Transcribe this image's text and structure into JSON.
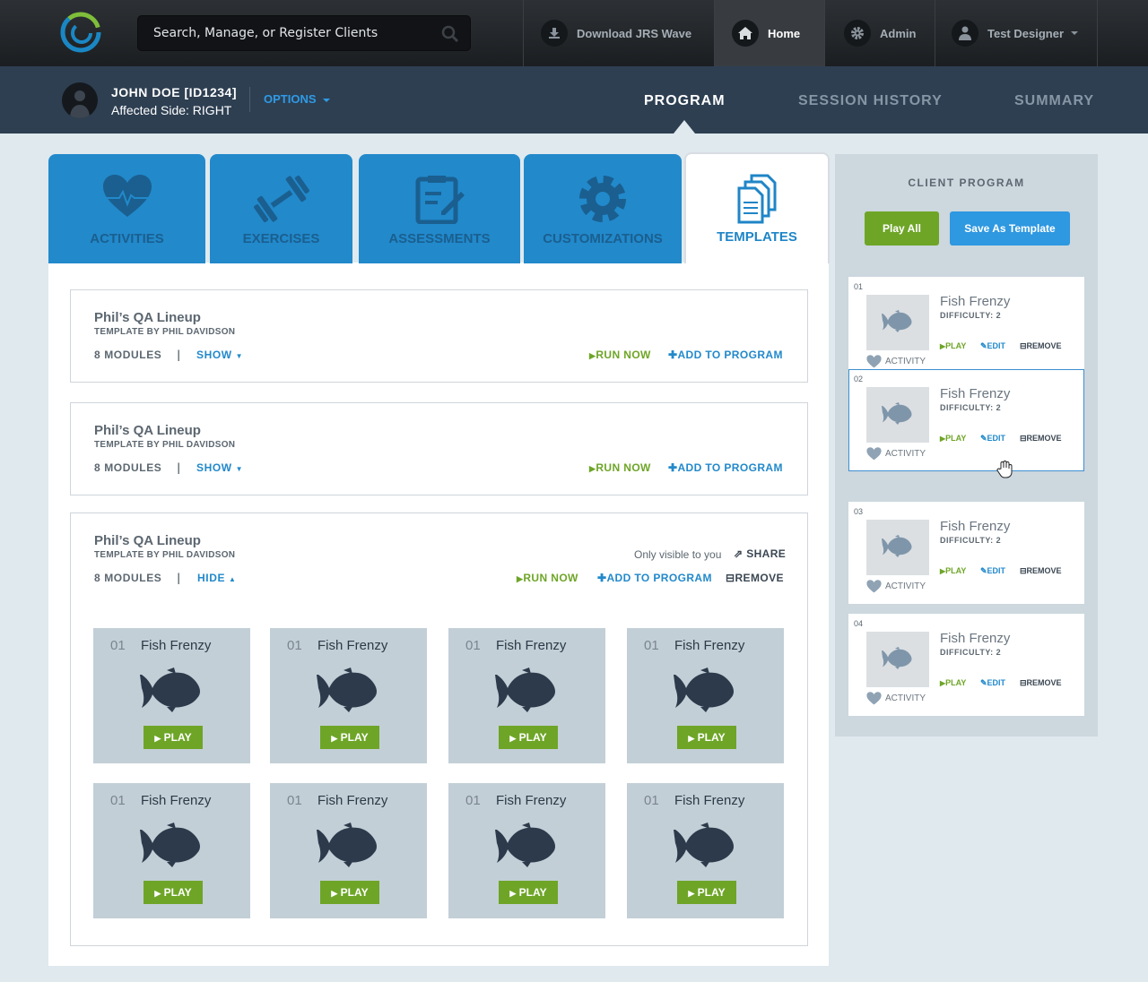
{
  "search": {
    "placeholder": "Search, Manage, or Register Clients"
  },
  "nav": {
    "download": "Download JRS Wave",
    "home": "Home",
    "admin": "Admin",
    "user": "Test Designer"
  },
  "client": {
    "name": "JOHN DOE [ID1234]",
    "side": "Affected Side: RIGHT",
    "options": "OPTIONS"
  },
  "client_tabs": {
    "program": "PROGRAM",
    "history": "SESSION HISTORY",
    "summary": "SUMMARY"
  },
  "category_tabs": {
    "activities": "ACTIVITIES",
    "exercises": "EXERCISES",
    "assessments": "ASSESSMENTS",
    "customizations": "CUSTOMIZATIONS",
    "templates": "TEMPLATES"
  },
  "templates": [
    {
      "title": "Phil’s QA Lineup",
      "by": "TEMPLATE BY PHIL DAVIDSON",
      "modules": "8 MODULES",
      "toggle": "SHOW",
      "run": "RUN NOW",
      "add": "ADD TO PROGRAM"
    },
    {
      "title": "Phil’s QA Lineup",
      "by": "TEMPLATE BY PHIL DAVIDSON",
      "modules": "8 MODULES",
      "toggle": "SHOW",
      "run": "RUN NOW",
      "add": "ADD TO PROGRAM"
    },
    {
      "title": "Phil’s QA Lineup",
      "by": "TEMPLATE BY PHIL DAVIDSON",
      "modules": "8 MODULES",
      "toggle": "HIDE",
      "run": "RUN NOW",
      "add": "ADD TO PROGRAM",
      "remove": "REMOVE",
      "visibility": "Only visible to you",
      "share": "SHARE"
    }
  ],
  "modules": [
    {
      "num": "01",
      "title": "Fish Frenzy",
      "play": "PLAY"
    },
    {
      "num": "01",
      "title": "Fish Frenzy",
      "play": "PLAY"
    },
    {
      "num": "01",
      "title": "Fish Frenzy",
      "play": "PLAY"
    },
    {
      "num": "01",
      "title": "Fish Frenzy",
      "play": "PLAY"
    },
    {
      "num": "01",
      "title": "Fish Frenzy",
      "play": "PLAY"
    },
    {
      "num": "01",
      "title": "Fish Frenzy",
      "play": "PLAY"
    },
    {
      "num": "01",
      "title": "Fish Frenzy",
      "play": "PLAY"
    },
    {
      "num": "01",
      "title": "Fish Frenzy",
      "play": "PLAY"
    }
  ],
  "sidebar": {
    "heading": "CLIENT PROGRAM",
    "play_all": "Play All",
    "save_template": "Save As Template",
    "items": [
      {
        "num": "01",
        "title": "Fish Frenzy",
        "difficulty": "DIFFICULTY: 2",
        "play": "PLAY",
        "edit": "EDIT",
        "remove": "REMOVE",
        "type": "ACTIVITY"
      },
      {
        "num": "02",
        "title": "Fish Frenzy",
        "difficulty": "DIFFICULTY: 2",
        "play": "PLAY",
        "edit": "EDIT",
        "remove": "REMOVE",
        "type": "ACTIVITY"
      },
      {
        "num": "03",
        "title": "Fish Frenzy",
        "difficulty": "DIFFICULTY: 2",
        "play": "PLAY",
        "edit": "EDIT",
        "remove": "REMOVE",
        "type": "ACTIVITY"
      },
      {
        "num": "04",
        "title": "Fish Frenzy",
        "difficulty": "DIFFICULTY: 2",
        "play": "PLAY",
        "edit": "EDIT",
        "remove": "REMOVE",
        "type": "ACTIVITY"
      }
    ]
  },
  "colors": {
    "accent_blue": "#2289cb",
    "accent_green": "#6ea527",
    "header_dark": "#2e3f52"
  }
}
